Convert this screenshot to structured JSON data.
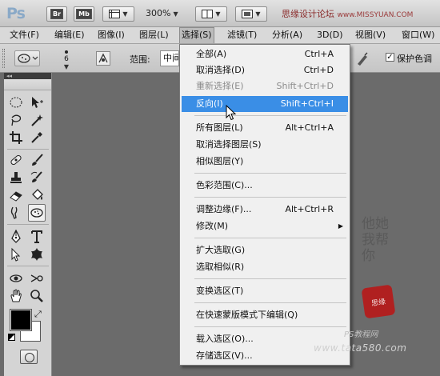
{
  "app_bar": {
    "logo": "Ps",
    "bridge_label": "Br",
    "minibridge_label": "Mb",
    "zoom": "300%",
    "watermark": "思缘设计论坛",
    "watermark_url": "www.MISSYUAN.COM"
  },
  "menubar": {
    "items": [
      {
        "label": "文件(F)"
      },
      {
        "label": "编辑(E)"
      },
      {
        "label": "图像(I)"
      },
      {
        "label": "图层(L)"
      },
      {
        "label": "选择(S)"
      },
      {
        "label": "滤镜(T)"
      },
      {
        "label": "分析(A)"
      },
      {
        "label": "3D(D)"
      },
      {
        "label": "视图(V)"
      },
      {
        "label": "窗口(W)"
      }
    ],
    "active_index": 4
  },
  "options_bar": {
    "brush_size": "6",
    "range_label": "范围:",
    "range_value": "中间",
    "protect_color_checked": true,
    "protect_color_label": "保护色调"
  },
  "select_menu": {
    "items": [
      {
        "label": "全部(A)",
        "shortcut": "Ctrl+A"
      },
      {
        "label": "取消选择(D)",
        "shortcut": "Ctrl+D"
      },
      {
        "label": "重新选择(E)",
        "shortcut": "Shift+Ctrl+D",
        "disabled": true
      },
      {
        "label": "反向(I)",
        "shortcut": "Shift+Ctrl+I",
        "highlighted": true
      },
      {
        "label": "所有图层(L)",
        "shortcut": "Alt+Ctrl+A"
      },
      {
        "label": "取消选择图层(S)",
        "shortcut": ""
      },
      {
        "label": "相似图层(Y)",
        "shortcut": ""
      },
      {
        "label": "色彩范围(C)...",
        "shortcut": ""
      },
      {
        "label": "调整边缘(F)...",
        "shortcut": "Alt+Ctrl+R"
      },
      {
        "label": "修改(M)",
        "shortcut": "",
        "submenu": true
      },
      {
        "label": "扩大选取(G)",
        "shortcut": ""
      },
      {
        "label": "选取相似(R)",
        "shortcut": ""
      },
      {
        "label": "变换选区(T)",
        "shortcut": ""
      },
      {
        "label": "在快速蒙版模式下编辑(Q)",
        "shortcut": ""
      },
      {
        "label": "载入选区(O)...",
        "shortcut": ""
      },
      {
        "label": "存储选区(V)...",
        "shortcut": ""
      }
    ]
  },
  "toolbox": {
    "collapse_label": "◂◂",
    "foreground_color": "#000000",
    "background_color": "#ffffff",
    "active_tool": "dodge-burn-sponge-tool"
  },
  "watermarks": {
    "calligraphy": "他她我帮你",
    "seal": "思缘",
    "line1": "PS教程网",
    "line2": "www.tata580.com"
  }
}
